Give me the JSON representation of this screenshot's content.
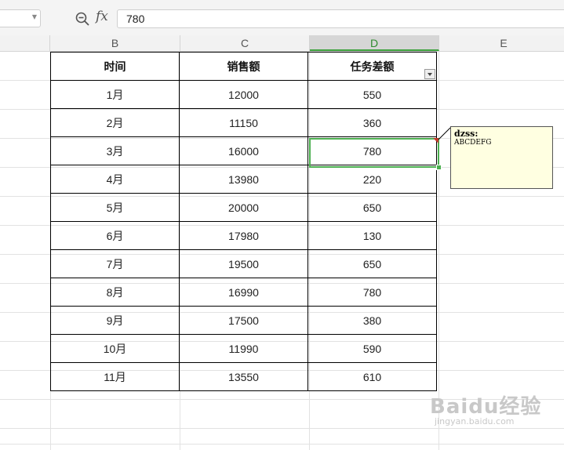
{
  "formula_bar": {
    "fx_label": "fx",
    "value": "780",
    "zoom_icon": "zoom-icon"
  },
  "columns": [
    "B",
    "C",
    "D",
    "E"
  ],
  "selected_column": "D",
  "table": {
    "headers": [
      "时间",
      "销售额",
      "任务差额"
    ],
    "rows": [
      [
        "1月",
        "12000",
        "550"
      ],
      [
        "2月",
        "11150",
        "360"
      ],
      [
        "3月",
        "16000",
        "780"
      ],
      [
        "4月",
        "13980",
        "220"
      ],
      [
        "5月",
        "20000",
        "650"
      ],
      [
        "6月",
        "17980",
        "130"
      ],
      [
        "7月",
        "19500",
        "650"
      ],
      [
        "8月",
        "16990",
        "780"
      ],
      [
        "9月",
        "17500",
        "380"
      ],
      [
        "10月",
        "11990",
        "590"
      ],
      [
        "11月",
        "13550",
        "610"
      ]
    ]
  },
  "comment": {
    "author": "dzss:",
    "text": "ABCDEFG"
  },
  "watermark": {
    "main": "Baidu经验",
    "url": "jingyan.baidu.com"
  },
  "colors": {
    "selection": "#4caf50",
    "comment_bg": "#ffffe1"
  }
}
